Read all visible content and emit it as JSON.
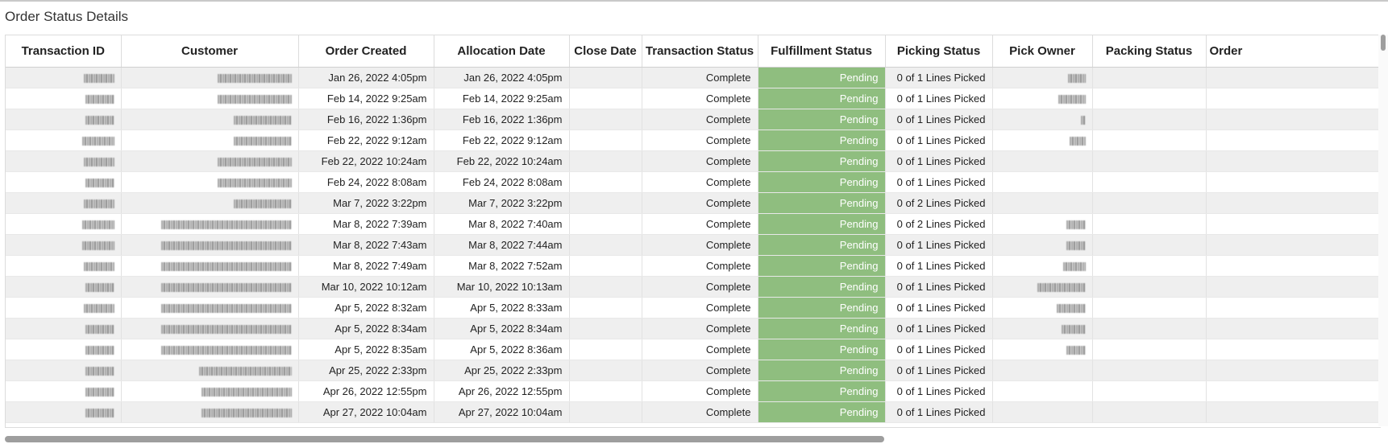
{
  "panel": {
    "title": "Order Status Details"
  },
  "table": {
    "columns": [
      "Transaction ID",
      "Customer",
      "Order Created",
      "Allocation Date",
      "Close Date",
      "Transaction Status",
      "Fulfillment Status",
      "Picking Status",
      "Pick Owner",
      "Packing Status",
      "Order"
    ],
    "rows": [
      {
        "order_created": "Jan 26, 2022 4:05pm",
        "allocation_date": "Jan 26, 2022 4:05pm",
        "close_date": "",
        "transaction_status": "Complete",
        "fulfillment_status": "Pending",
        "picking_status": "0 of 1 Lines Picked",
        "packing_status": ""
      },
      {
        "order_created": "Feb 14, 2022 9:25am",
        "allocation_date": "Feb 14, 2022 9:25am",
        "close_date": "",
        "transaction_status": "Complete",
        "fulfillment_status": "Pending",
        "picking_status": "0 of 1 Lines Picked",
        "packing_status": ""
      },
      {
        "order_created": "Feb 16, 2022 1:36pm",
        "allocation_date": "Feb 16, 2022 1:36pm",
        "close_date": "",
        "transaction_status": "Complete",
        "fulfillment_status": "Pending",
        "picking_status": "0 of 1 Lines Picked",
        "packing_status": ""
      },
      {
        "order_created": "Feb 22, 2022 9:12am",
        "allocation_date": "Feb 22, 2022 9:12am",
        "close_date": "",
        "transaction_status": "Complete",
        "fulfillment_status": "Pending",
        "picking_status": "0 of 1 Lines Picked",
        "packing_status": ""
      },
      {
        "order_created": "Feb 22, 2022 10:24am",
        "allocation_date": "Feb 22, 2022 10:24am",
        "close_date": "",
        "transaction_status": "Complete",
        "fulfillment_status": "Pending",
        "picking_status": "0 of 1 Lines Picked",
        "packing_status": ""
      },
      {
        "order_created": "Feb 24, 2022 8:08am",
        "allocation_date": "Feb 24, 2022 8:08am",
        "close_date": "",
        "transaction_status": "Complete",
        "fulfillment_status": "Pending",
        "picking_status": "0 of 1 Lines Picked",
        "packing_status": ""
      },
      {
        "order_created": "Mar 7, 2022 3:22pm",
        "allocation_date": "Mar 7, 2022 3:22pm",
        "close_date": "",
        "transaction_status": "Complete",
        "fulfillment_status": "Pending",
        "picking_status": "0 of 2 Lines Picked",
        "packing_status": ""
      },
      {
        "order_created": "Mar 8, 2022 7:39am",
        "allocation_date": "Mar 8, 2022 7:40am",
        "close_date": "",
        "transaction_status": "Complete",
        "fulfillment_status": "Pending",
        "picking_status": "0 of 2 Lines Picked",
        "packing_status": ""
      },
      {
        "order_created": "Mar 8, 2022 7:43am",
        "allocation_date": "Mar 8, 2022 7:44am",
        "close_date": "",
        "transaction_status": "Complete",
        "fulfillment_status": "Pending",
        "picking_status": "0 of 1 Lines Picked",
        "packing_status": ""
      },
      {
        "order_created": "Mar 8, 2022 7:49am",
        "allocation_date": "Mar 8, 2022 7:52am",
        "close_date": "",
        "transaction_status": "Complete",
        "fulfillment_status": "Pending",
        "picking_status": "0 of 1 Lines Picked",
        "packing_status": ""
      },
      {
        "order_created": "Mar 10, 2022 10:12am",
        "allocation_date": "Mar 10, 2022 10:13am",
        "close_date": "",
        "transaction_status": "Complete",
        "fulfillment_status": "Pending",
        "picking_status": "0 of 1 Lines Picked",
        "packing_status": ""
      },
      {
        "order_created": "Apr 5, 2022 8:32am",
        "allocation_date": "Apr 5, 2022 8:33am",
        "close_date": "",
        "transaction_status": "Complete",
        "fulfillment_status": "Pending",
        "picking_status": "0 of 1 Lines Picked",
        "packing_status": ""
      },
      {
        "order_created": "Apr 5, 2022 8:34am",
        "allocation_date": "Apr 5, 2022 8:34am",
        "close_date": "",
        "transaction_status": "Complete",
        "fulfillment_status": "Pending",
        "picking_status": "0 of 1 Lines Picked",
        "packing_status": ""
      },
      {
        "order_created": "Apr 5, 2022 8:35am",
        "allocation_date": "Apr 5, 2022 8:36am",
        "close_date": "",
        "transaction_status": "Complete",
        "fulfillment_status": "Pending",
        "picking_status": "0 of 1 Lines Picked",
        "packing_status": ""
      },
      {
        "order_created": "Apr 25, 2022 2:33pm",
        "allocation_date": "Apr 25, 2022 2:33pm",
        "close_date": "",
        "transaction_status": "Complete",
        "fulfillment_status": "Pending",
        "picking_status": "0 of 1 Lines Picked",
        "packing_status": ""
      },
      {
        "order_created": "Apr 26, 2022 12:55pm",
        "allocation_date": "Apr 26, 2022 12:55pm",
        "close_date": "",
        "transaction_status": "Complete",
        "fulfillment_status": "Pending",
        "picking_status": "0 of 1 Lines Picked",
        "packing_status": ""
      },
      {
        "order_created": "Apr 27, 2022 10:04am",
        "allocation_date": "Apr 27, 2022 10:04am",
        "close_date": "",
        "transaction_status": "Complete",
        "fulfillment_status": "Pending",
        "picking_status": "0 of 1 Lines Picked",
        "packing_status": ""
      }
    ]
  },
  "colors": {
    "fulfillment_pending_bg": "#8fbe7f",
    "row_alt_bg": "#efefef",
    "scrollbar_thumb": "#9e9e9e"
  },
  "scroll": {
    "horizontal_visible_fraction": 0.64
  }
}
